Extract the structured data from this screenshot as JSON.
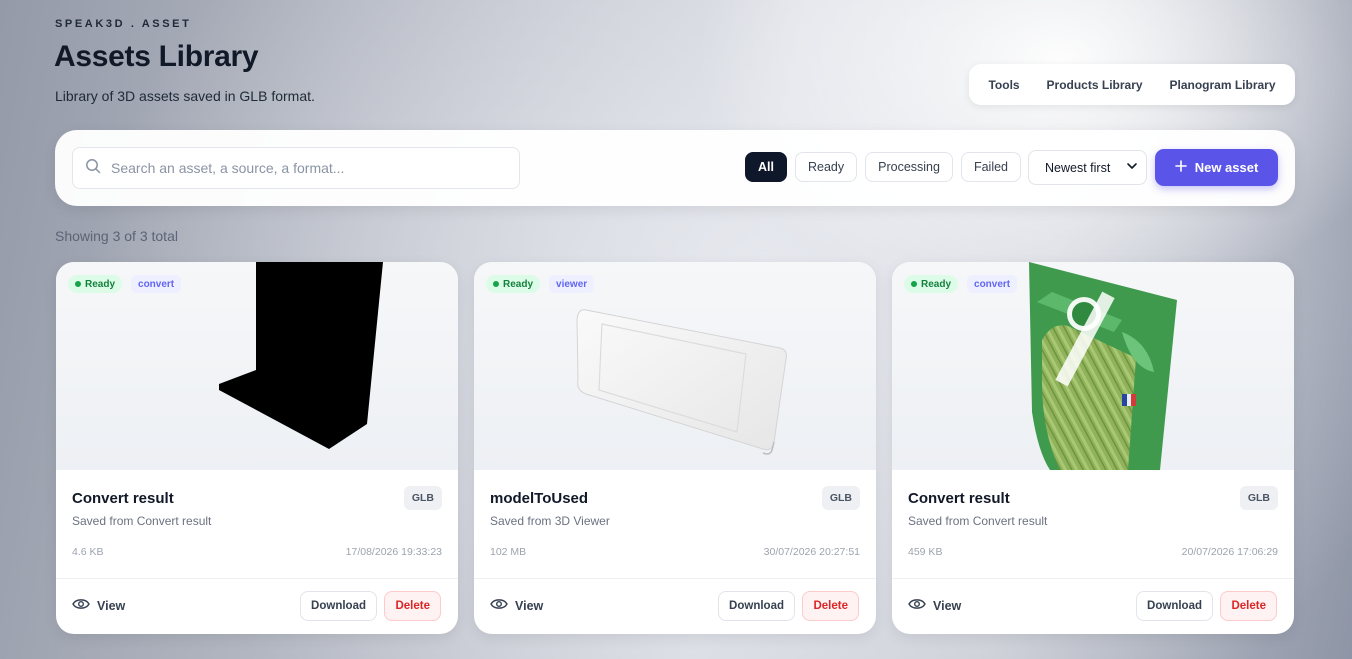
{
  "brand": "SPEAK3D . ASSET",
  "header": {
    "title": "Assets Library",
    "subtitle": "Library of 3D assets saved in GLB format."
  },
  "topnav": {
    "items": [
      "Tools",
      "Products Library",
      "Planogram Library"
    ]
  },
  "toolbar": {
    "search_placeholder": "Search an asset, a source, a format...",
    "search_value": "",
    "filters": [
      "All",
      "Ready",
      "Processing",
      "Failed"
    ],
    "active_filter": "All",
    "sort_selected": "Newest first",
    "new_asset_label": "New asset"
  },
  "count_text": "Showing 3 of 3 total",
  "cards": [
    {
      "status": "Ready",
      "tag": "convert",
      "title": "Convert result",
      "format": "GLB",
      "description": "Saved from Convert result",
      "size": "4.6 KB",
      "date": "17/08/2026 19:33:23",
      "view_label": "View",
      "download_label": "Download",
      "delete_label": "Delete"
    },
    {
      "status": "Ready",
      "tag": "viewer",
      "title": "modelToUsed",
      "format": "GLB",
      "description": "Saved from 3D Viewer",
      "size": "102 MB",
      "date": "30/07/2026 20:27:51",
      "view_label": "View",
      "download_label": "Download",
      "delete_label": "Delete"
    },
    {
      "status": "Ready",
      "tag": "convert",
      "title": "Convert result",
      "format": "GLB",
      "description": "Saved from Convert result",
      "size": "459 KB",
      "date": "20/07/2026 17:06:29",
      "view_label": "View",
      "download_label": "Download",
      "delete_label": "Delete"
    }
  ],
  "icons": {
    "search": "search-icon",
    "chevron": "chevron-down-icon",
    "plus": "plus-icon",
    "view": "eye-icon"
  },
  "colors": {
    "accent": "#5b54e8",
    "active_chip": "#0f172a",
    "ready_badge": "#dcfce7",
    "delete": "#dc2626"
  }
}
